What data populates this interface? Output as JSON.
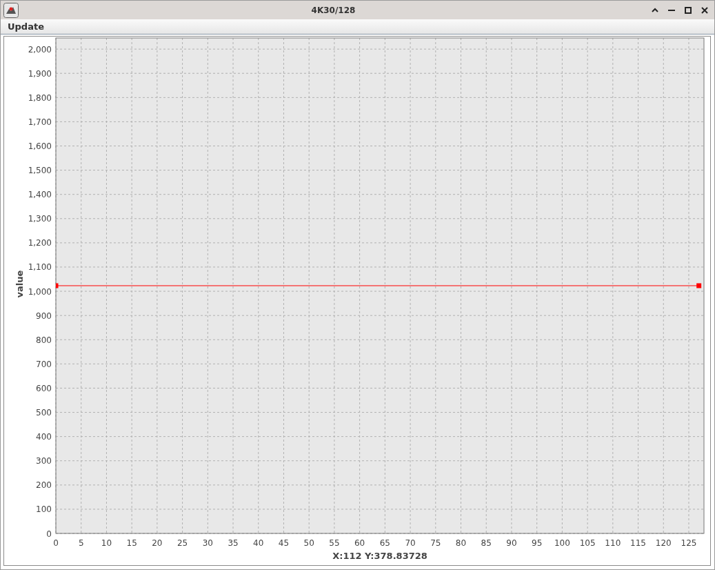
{
  "window": {
    "title": "4K30/128"
  },
  "menu": [
    "Update"
  ],
  "chart": {
    "chart_data": {
      "type": "line",
      "xlabel": "X:112 Y:378.83728",
      "ylabel": "value",
      "x": [
        0,
        127
      ],
      "series": [
        {
          "color": "#ff0000",
          "marker": "square",
          "values": [
            1023,
            1023
          ]
        }
      ],
      "grid": true,
      "xlim": [
        0,
        128
      ],
      "ylim": [
        0,
        2046
      ],
      "xticks": [
        0,
        5,
        10,
        15,
        20,
        25,
        30,
        35,
        40,
        45,
        50,
        55,
        60,
        65,
        70,
        75,
        80,
        85,
        90,
        95,
        100,
        105,
        110,
        115,
        120,
        125
      ],
      "yticks": [
        {
          "value": 0,
          "label": "0"
        },
        {
          "value": 100,
          "label": "100"
        },
        {
          "value": 200,
          "label": "200"
        },
        {
          "value": 300,
          "label": "300"
        },
        {
          "value": 400,
          "label": "400"
        },
        {
          "value": 500,
          "label": "500"
        },
        {
          "value": 600,
          "label": "600"
        },
        {
          "value": 700,
          "label": "700"
        },
        {
          "value": 800,
          "label": "800"
        },
        {
          "value": 900,
          "label": "900"
        },
        {
          "value": 1000,
          "label": "1,000"
        },
        {
          "value": 1100,
          "label": "1,100"
        },
        {
          "value": 1200,
          "label": "1,200"
        },
        {
          "value": 1300,
          "label": "1,300"
        },
        {
          "value": 1400,
          "label": "1,400"
        },
        {
          "value": 1500,
          "label": "1,500"
        },
        {
          "value": 1600,
          "label": "1,600"
        },
        {
          "value": 1700,
          "label": "1,700"
        },
        {
          "value": 1800,
          "label": "1,800"
        },
        {
          "value": 1900,
          "label": "1,900"
        },
        {
          "value": 2000,
          "label": "2,000"
        }
      ]
    }
  }
}
